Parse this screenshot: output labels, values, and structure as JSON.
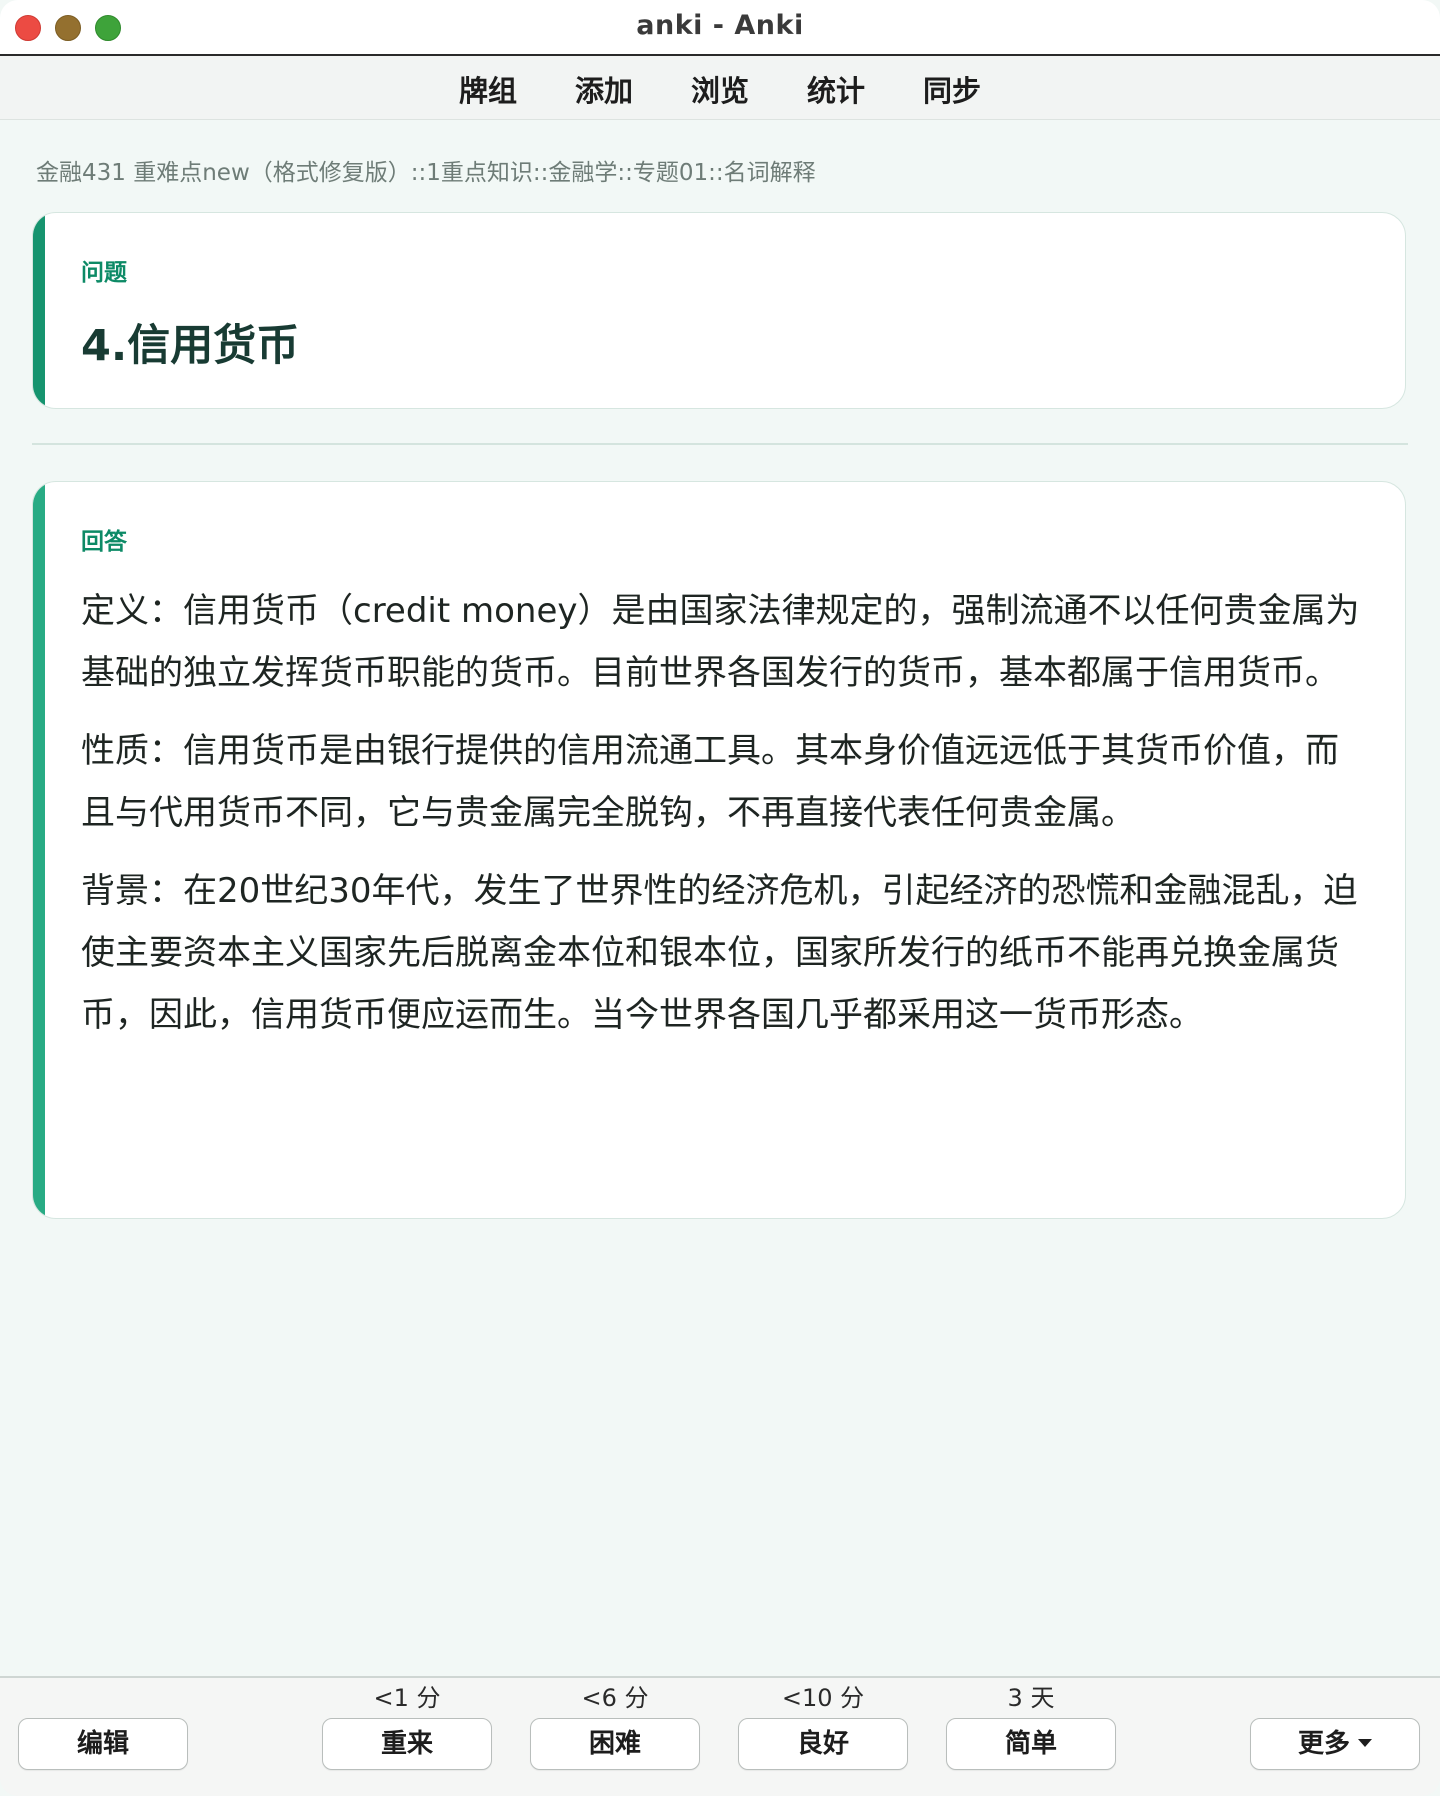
{
  "window": {
    "title": "anki - Anki"
  },
  "top_menu": {
    "items": [
      "牌组",
      "添加",
      "浏览",
      "统计",
      "同步"
    ]
  },
  "breadcrumb": "金融431 重难点new（格式修复版）::1重点知识::金融学::专题01::名词解释",
  "question": {
    "label": "问题",
    "text": "4.信用货币"
  },
  "answer": {
    "label": "回答",
    "paragraphs": [
      "定义：信用货币（credit money）是由国家法律规定的，强制流通不以任何贵金属为基础的独立发挥货币职能的货币。目前世界各国发行的货币，基本都属于信用货币。",
      "性质：信用货币是由银行提供的信用流通工具。其本身价值远远低于其货币价值，而且与代用货币不同，它与贵金属完全脱钩，不再直接代表任何贵金属。",
      "背景：在20世纪30年代，发生了世界性的经济危机，引起经济的恐慌和金融混乱，迫使主要资本主义国家先后脱离金本位和银本位，国家所发行的纸币不能再兑换金属货币，因此，信用货币便应运而生。当今世界各国几乎都采用这一货币形态。"
    ]
  },
  "bottom_bar": {
    "edit_label": "编辑",
    "more_label": "更多",
    "answers": [
      {
        "interval": "<1 分",
        "label": "重来"
      },
      {
        "interval": "<6 分",
        "label": "困难"
      },
      {
        "interval": "<10 分",
        "label": "良好"
      },
      {
        "interval": "3 天",
        "label": "简单"
      }
    ]
  },
  "colors": {
    "accent_question": "#16946f",
    "accent_answer": "#28ab84",
    "label_text": "#0d8a66",
    "background": "#f2f8f6"
  }
}
